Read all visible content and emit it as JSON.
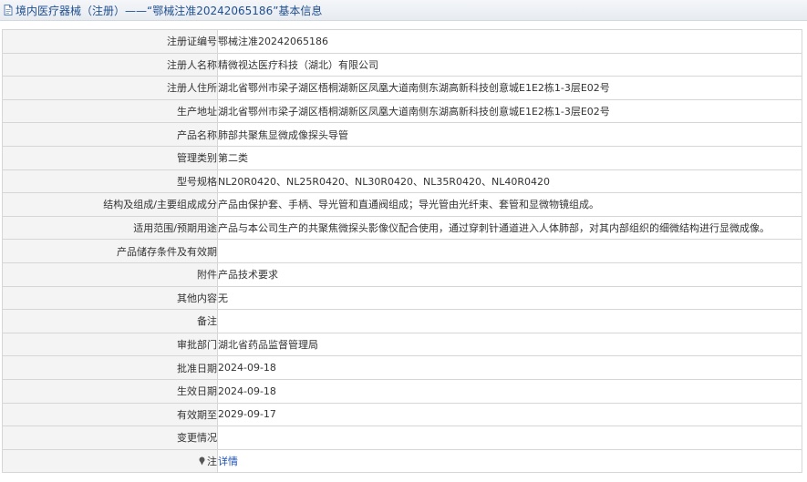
{
  "header": {
    "title": "境内医疗器械（注册）——“鄂械注准20242065186”基本信息",
    "icon": "document-icon"
  },
  "rows": [
    {
      "label": "注册证编号",
      "value": "鄂械注准20242065186"
    },
    {
      "label": "注册人名称",
      "value": "精微视达医疗科技（湖北）有限公司"
    },
    {
      "label": "注册人住所",
      "value": "湖北省鄂州市梁子湖区梧桐湖新区凤凰大道南侧东湖高新科技创意城E1E2栋1-3层E02号"
    },
    {
      "label": "生产地址",
      "value": "湖北省鄂州市梁子湖区梧桐湖新区凤凰大道南侧东湖高新科技创意城E1E2栋1-3层E02号"
    },
    {
      "label": "产品名称",
      "value": "肺部共聚焦显微成像探头导管"
    },
    {
      "label": "管理类别",
      "value": "第二类"
    },
    {
      "label": "型号规格",
      "value": "NL20R0420、NL25R0420、NL30R0420、NL35R0420、NL40R0420"
    },
    {
      "label": "结构及组成/主要组成成分",
      "value": "产品由保护套、手柄、导光管和直通阀组成；导光管由光纤束、套管和显微物镜组成。"
    },
    {
      "label": "适用范围/预期用途",
      "value": "产品与本公司生产的共聚焦微探头影像仪配合使用，通过穿刺针通道进入人体肺部，对其内部组织的细微结构进行显微成像。"
    },
    {
      "label": "产品储存条件及有效期",
      "value": ""
    },
    {
      "label": "附件",
      "value": "产品技术要求"
    },
    {
      "label": "其他内容",
      "value": "无"
    },
    {
      "label": "备注",
      "value": ""
    },
    {
      "label": "审批部门",
      "value": "湖北省药品监督管理局"
    },
    {
      "label": "批准日期",
      "value": "2024-09-18"
    },
    {
      "label": "生效日期",
      "value": "2024-09-18"
    },
    {
      "label": "有效期至",
      "value": "2029-09-17"
    },
    {
      "label": "变更情况",
      "value": ""
    }
  ],
  "note_row": {
    "label": "注",
    "link_text": "详情",
    "icon": "pin-icon"
  },
  "colors": {
    "link": "#1c4fb6",
    "header_text": "#1f4f8f",
    "label_bg": "#f4f4f4",
    "border": "#d6d6d6"
  }
}
